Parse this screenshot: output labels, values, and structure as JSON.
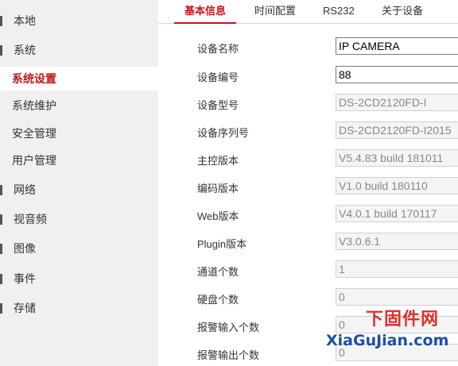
{
  "sidebar": {
    "items": [
      {
        "label": "本地",
        "type": "top",
        "active": false
      },
      {
        "label": "系统",
        "type": "top",
        "active": false
      },
      {
        "label": "系统设置",
        "type": "sub",
        "active": true
      },
      {
        "label": "系统维护",
        "type": "sub",
        "active": false
      },
      {
        "label": "安全管理",
        "type": "sub",
        "active": false
      },
      {
        "label": "用户管理",
        "type": "sub",
        "active": false
      },
      {
        "label": "网络",
        "type": "top",
        "active": false
      },
      {
        "label": "视音频",
        "type": "top",
        "active": false
      },
      {
        "label": "图像",
        "type": "top",
        "active": false
      },
      {
        "label": "事件",
        "type": "top",
        "active": false
      },
      {
        "label": "存储",
        "type": "top",
        "active": false
      }
    ]
  },
  "tabs": [
    {
      "label": "基本信息",
      "active": true
    },
    {
      "label": "时间配置",
      "active": false
    },
    {
      "label": "RS232",
      "active": false
    },
    {
      "label": "关于设备",
      "active": false
    }
  ],
  "form": {
    "rows": [
      {
        "label": "设备名称",
        "value": "IP CAMERA",
        "editable": true
      },
      {
        "label": "设备编号",
        "value": "88",
        "editable": true
      },
      {
        "label": "设备型号",
        "value": "DS-2CD2120FD-I",
        "editable": false
      },
      {
        "label": "设备序列号",
        "value": "DS-2CD2120FD-I2015",
        "editable": false
      },
      {
        "label": "主控版本",
        "value": "V5.4.83 build 181011",
        "editable": false
      },
      {
        "label": "编码版本",
        "value": "V1.0 build 180110",
        "editable": false
      },
      {
        "label": "Web版本",
        "value": "V4.0.1 build 170117",
        "editable": false
      },
      {
        "label": "Plugin版本",
        "value": "V3.0.6.1",
        "editable": false
      },
      {
        "label": "通道个数",
        "value": "1",
        "editable": false
      },
      {
        "label": "硬盘个数",
        "value": "0",
        "editable": false
      },
      {
        "label": "报警输入个数",
        "value": "0",
        "editable": false
      },
      {
        "label": "报警输出个数",
        "value": "0",
        "editable": false
      }
    ]
  },
  "watermark": {
    "cn": "下固件网",
    "en": "XiaGuJian.com"
  },
  "colors": {
    "accent": "#c01818",
    "sidebar_bg": "#f0f0f0",
    "readonly_bg": "#f4f4f4"
  }
}
